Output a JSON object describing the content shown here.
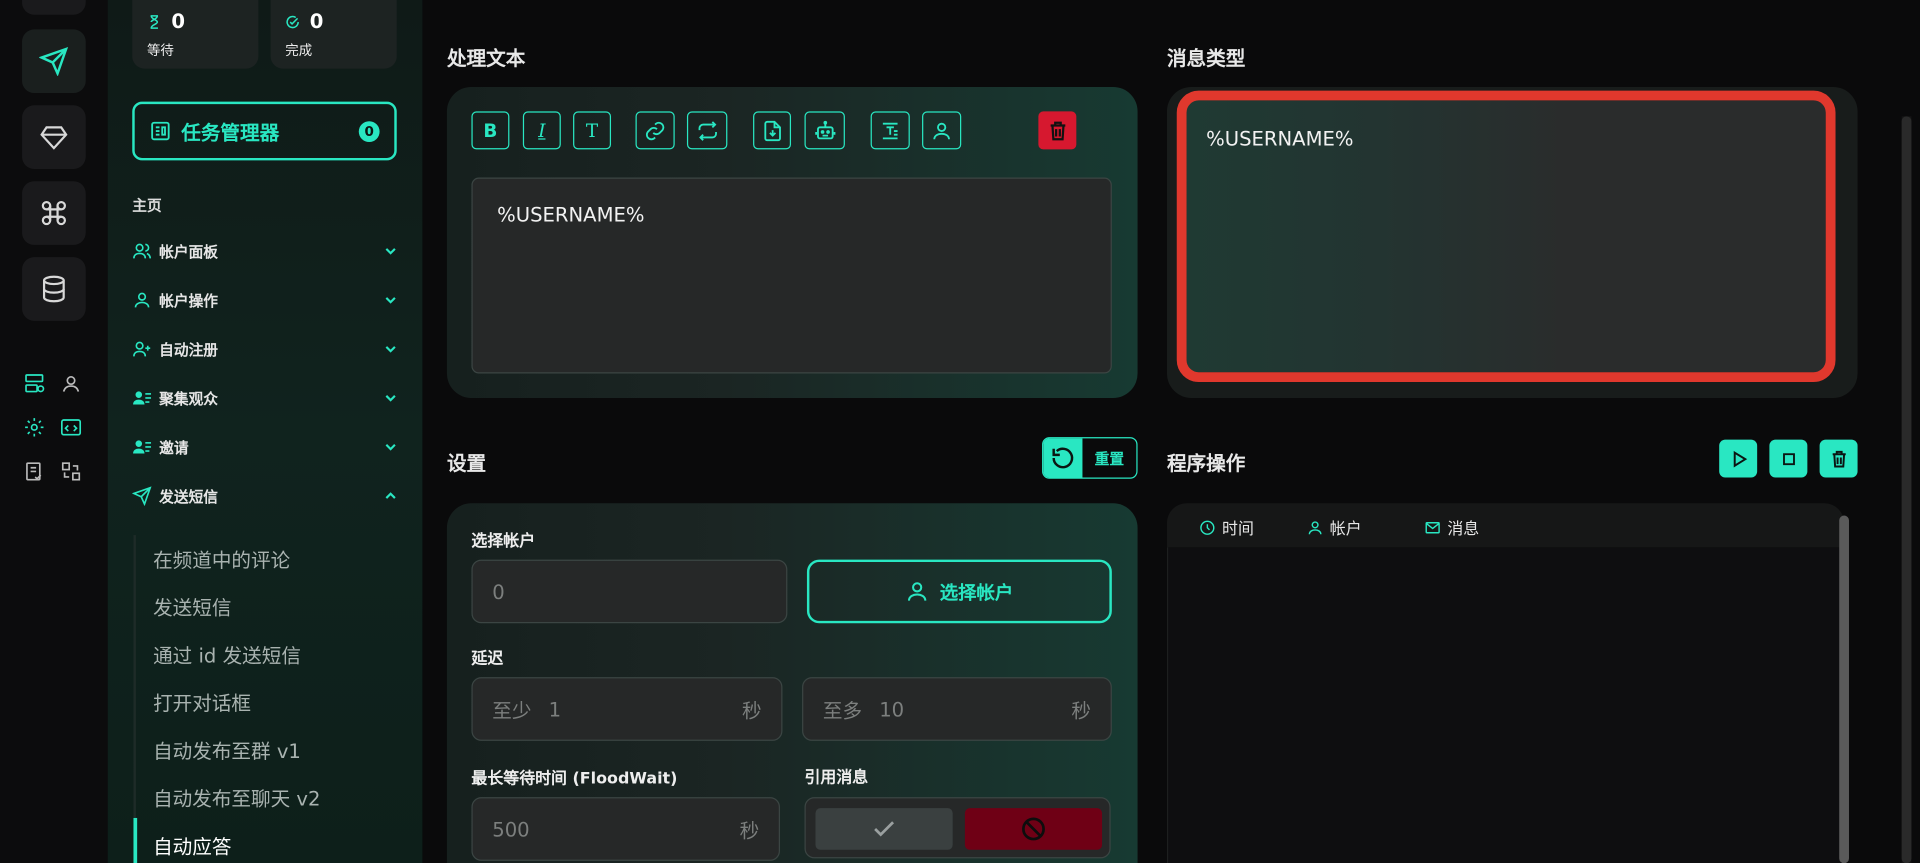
{
  "stats": [
    {
      "value": "0",
      "label": "等待",
      "icon": "hourglass-icon"
    },
    {
      "value": "0",
      "label": "完成",
      "icon": "check-circle-icon"
    }
  ],
  "task_manager": {
    "label": "任务管理器",
    "count": "0"
  },
  "sidebar": {
    "home": "主页",
    "items": [
      {
        "label": "帐户面板",
        "icon": "users-icon"
      },
      {
        "label": "帐户操作",
        "icon": "user-icon"
      },
      {
        "label": "自动注册",
        "icon": "user-plus-icon"
      },
      {
        "label": "聚集观众",
        "icon": "user-list-icon"
      },
      {
        "label": "邀请",
        "icon": "user-list-icon"
      },
      {
        "label": "发送短信",
        "icon": "send-icon"
      }
    ],
    "subitems": [
      "在频道中的评论",
      "发送短信",
      "通过 id 发送短信",
      "打开对话框",
      "自动发布至群 v1",
      "自动发布至聊天 v2",
      "自动应答"
    ]
  },
  "main": {
    "process_text": {
      "title": "处理文本",
      "toolbar": [
        "B",
        "I",
        "T"
      ],
      "text": "%USERNAME%"
    },
    "message_type": {
      "title": "消息类型",
      "text": "%USERNAME%"
    },
    "settings": {
      "title": "设置",
      "reset_label": "重置",
      "select_account_label": "选择帐户",
      "account_value": "0",
      "select_account_button": "选择帐户",
      "delay_label": "延迟",
      "delay_min_prefix": "至少",
      "delay_min": "1",
      "delay_max_prefix": "至多",
      "delay_max": "10",
      "unit_seconds": "秒",
      "floodwait_label": "最长等待时间 (FloodWait)",
      "floodwait_value": "500",
      "quote_label": "引用消息"
    },
    "program": {
      "title": "程序操作",
      "columns": [
        "时间",
        "帐户",
        "消息"
      ]
    }
  },
  "colors": {
    "accent": "#29e7c2",
    "danger": "#d6182f",
    "highlight": "#e0382d"
  }
}
